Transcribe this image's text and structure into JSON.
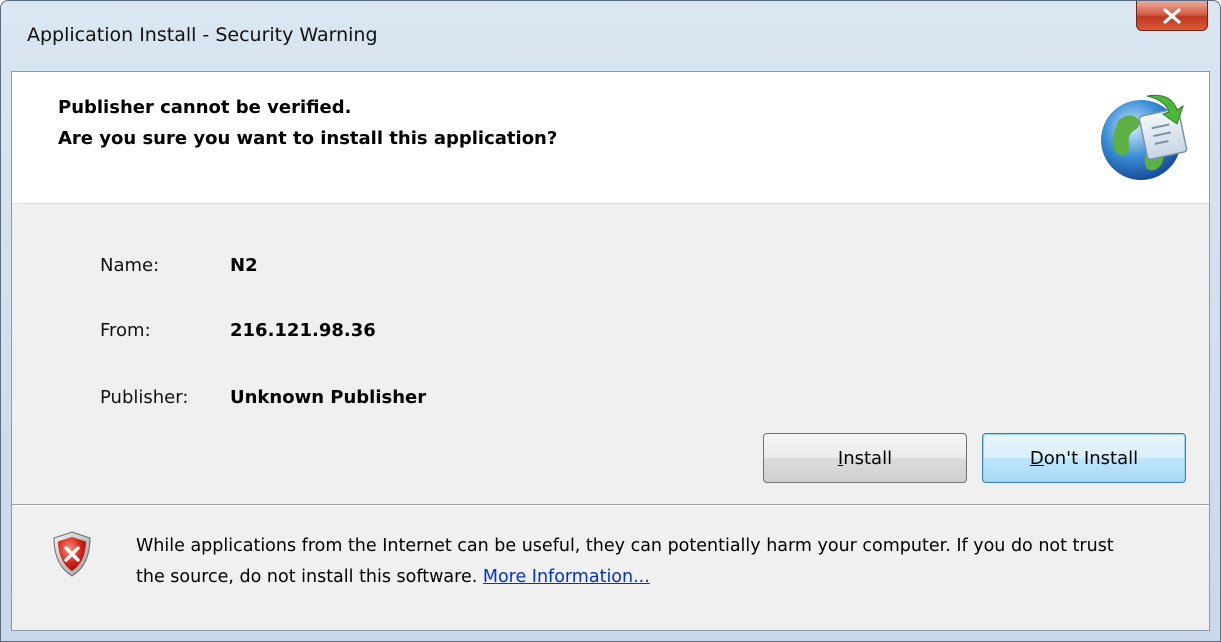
{
  "window": {
    "title": "Application Install - Security Warning",
    "close_glyph": "X"
  },
  "header": {
    "line1": "Publisher cannot be verified.",
    "line2": "Are you sure you want to install this application?",
    "icon": "globe-install-icon"
  },
  "details": {
    "name_label": "Name:",
    "name_value": "N2",
    "from_label": "From:",
    "from_value": "216.121.98.36",
    "publisher_label": "Publisher:",
    "publisher_value": "Unknown Publisher"
  },
  "buttons": {
    "install_mnemonic": "I",
    "install_rest": "nstall",
    "dont_mnemonic": "D",
    "dont_rest": "on't Install"
  },
  "footer": {
    "warning_text": "While applications from the Internet can be useful, they can potentially harm your computer. If you do not trust the source, do not install this software.",
    "more_info_link": "More Information...",
    "icon": "shield-warning-icon"
  },
  "colors": {
    "link": "#0033cc",
    "close_button": "#c0361d",
    "default_button_border": "#3c7fb1"
  }
}
